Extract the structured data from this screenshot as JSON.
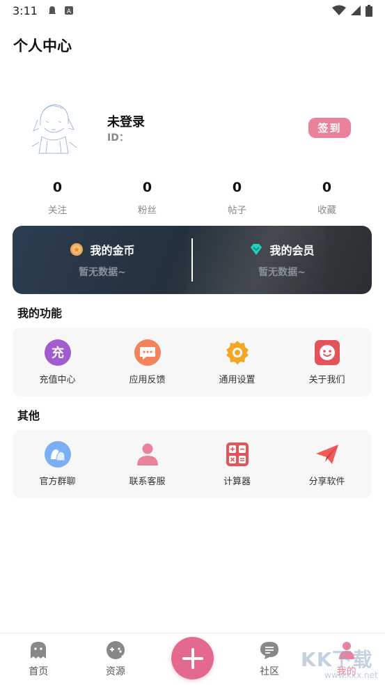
{
  "status_bar": {
    "time": "3:11"
  },
  "header": {
    "title": "个人中心"
  },
  "profile": {
    "name": "未登录",
    "id_label": "ID：",
    "checkin_label": "签到"
  },
  "stats": [
    {
      "value": "0",
      "label": "关注"
    },
    {
      "value": "0",
      "label": "粉丝"
    },
    {
      "value": "0",
      "label": "帖子"
    },
    {
      "value": "0",
      "label": "收藏"
    }
  ],
  "wallet": {
    "coins": {
      "title": "我的金币",
      "subtitle": "暂无数据~",
      "icon": "coin-icon"
    },
    "vip": {
      "title": "我的会员",
      "subtitle": "暂无数据~",
      "icon": "diamond-icon"
    }
  },
  "functions": {
    "title": "我的功能",
    "items": [
      {
        "label": "充值中心",
        "icon": "recharge-icon",
        "icon_text": "充",
        "color": "#a35bd0"
      },
      {
        "label": "应用反馈",
        "icon": "feedback-icon",
        "color": "#f2835c"
      },
      {
        "label": "通用设置",
        "icon": "gear-icon",
        "color": "#f5a623"
      },
      {
        "label": "关于我们",
        "icon": "smile-icon",
        "color": "#e5535a"
      }
    ]
  },
  "others": {
    "title": "其他",
    "items": [
      {
        "label": "官方群聊",
        "icon": "group-chat-icon",
        "color": "#7aaef5"
      },
      {
        "label": "联系客服",
        "icon": "person-icon",
        "color": "#e9829a"
      },
      {
        "label": "计算器",
        "icon": "calculator-icon",
        "color": "#e5535a"
      },
      {
        "label": "分享软件",
        "icon": "send-icon",
        "color": "#ef5a5a"
      }
    ]
  },
  "bottom_nav": {
    "items": [
      {
        "label": "首页",
        "icon": "ghost-icon"
      },
      {
        "label": "资源",
        "icon": "gamepad-icon"
      },
      {
        "label": "社区",
        "icon": "chat-icon"
      },
      {
        "label": "我的",
        "icon": "profile-icon",
        "active": true
      }
    ],
    "fab_icon": "plus-icon"
  },
  "watermark": {
    "text": "KK下载",
    "url": "www.kkx.net"
  },
  "colors": {
    "accent": "#e9829a",
    "fab": "#e46a8d",
    "card_bg": "#f7f7f7",
    "wallet_bg": "#2a3540"
  }
}
